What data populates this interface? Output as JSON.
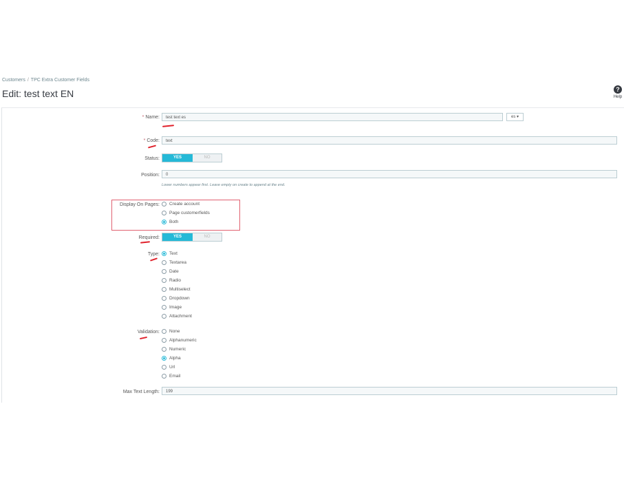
{
  "breadcrumb": {
    "parent": "Customers",
    "separator": "/",
    "current": "TPC Extra Customer Fields"
  },
  "title": "Edit: test text EN",
  "help": {
    "icon": "question-circle-icon",
    "label": "Help"
  },
  "form": {
    "name": {
      "label": "Name:",
      "required_mark": "*",
      "value": "test text es",
      "lang": "es ▾"
    },
    "code": {
      "label": "Code:",
      "required_mark": "*",
      "value": "text"
    },
    "status": {
      "label": "Status:",
      "yes": "YES",
      "no": "NO",
      "selected": "YES"
    },
    "position": {
      "label": "Position:",
      "value": "0",
      "help": "Lower numbers appear first. Leave empty on create to append at the end."
    },
    "display_on_pages": {
      "label": "Display On Pages:",
      "options": [
        {
          "label": "Create account",
          "checked": false
        },
        {
          "label": "Page customerfields",
          "checked": false
        },
        {
          "label": "Both",
          "checked": true
        }
      ]
    },
    "required": {
      "label": "Required:",
      "yes": "YES",
      "no": "NO",
      "selected": "YES"
    },
    "type": {
      "label": "Type:",
      "options": [
        {
          "label": "Text",
          "checked": true
        },
        {
          "label": "Textarea",
          "checked": false
        },
        {
          "label": "Date",
          "checked": false
        },
        {
          "label": "Radio",
          "checked": false
        },
        {
          "label": "Multiselect",
          "checked": false
        },
        {
          "label": "Dropdown",
          "checked": false
        },
        {
          "label": "Image",
          "checked": false
        },
        {
          "label": "Attachment",
          "checked": false
        }
      ]
    },
    "validation": {
      "label": "Validation:",
      "options": [
        {
          "label": "None",
          "checked": false
        },
        {
          "label": "Alphanumeric",
          "checked": false
        },
        {
          "label": "Numeric",
          "checked": false
        },
        {
          "label": "Alpha",
          "checked": true
        },
        {
          "label": "Url",
          "checked": false
        },
        {
          "label": "Email",
          "checked": false
        }
      ]
    },
    "max_text_length": {
      "label": "Max Text Length:",
      "value": "199"
    }
  },
  "colors": {
    "accent": "#25b9d7",
    "annotation": "#e0202a",
    "highlight_border": "#e06070"
  }
}
